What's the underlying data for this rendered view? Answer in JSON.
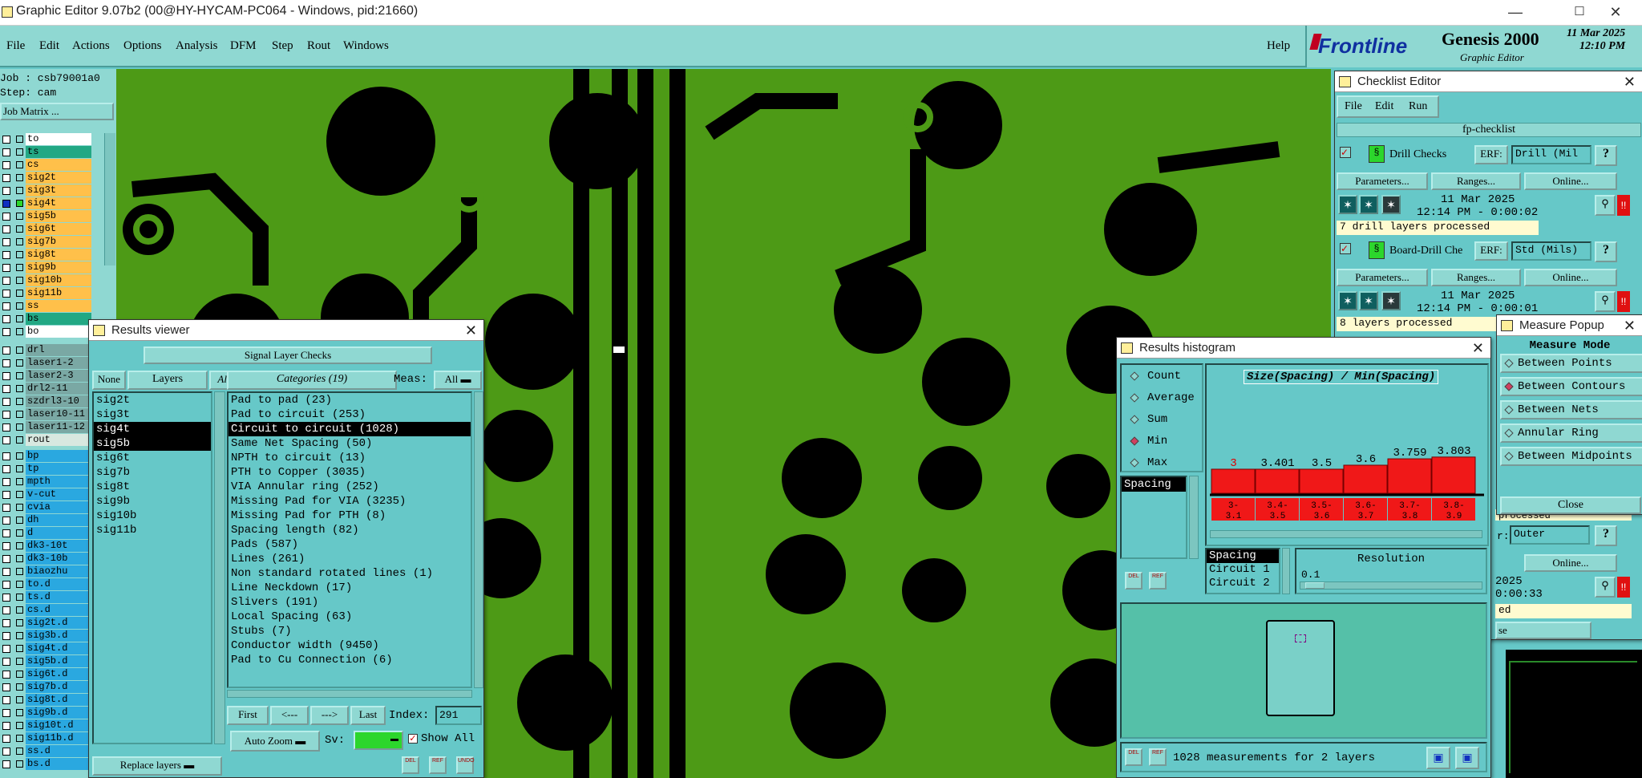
{
  "window": {
    "title": "Graphic Editor 9.07b2 (00@HY-HYCAM-PC064 - Windows, pid:21660)",
    "minimize": "—",
    "maximize": "☐",
    "close": "✕"
  },
  "menubar": {
    "items": [
      "File",
      "Edit",
      "Actions",
      "Options",
      "Analysis",
      "DFM",
      "Step",
      "Rout",
      "Windows"
    ],
    "help": "Help"
  },
  "brand": {
    "logo": "Frontline",
    "product": "Genesis 2000",
    "subtitle": "Graphic Editor",
    "date": "11 Mar 2025",
    "time": "12:10 PM"
  },
  "job": {
    "job": "Job : csb79001a0",
    "step": "Step: cam",
    "matrix_button": "Job Matrix ..."
  },
  "layers": {
    "group1": [
      {
        "name": "to",
        "color": "#ffffff"
      },
      {
        "name": "ts",
        "color": "#22a884"
      },
      {
        "name": "cs",
        "color": "#ffc04a"
      },
      {
        "name": "sig2t",
        "color": "#ffc04a"
      },
      {
        "name": "sig3t",
        "color": "#ffc04a"
      },
      {
        "name": "sig4t",
        "color": "#ffc04a"
      },
      {
        "name": "sig5b",
        "color": "#ffc04a"
      },
      {
        "name": "sig6t",
        "color": "#ffc04a"
      },
      {
        "name": "sig7b",
        "color": "#ffc04a"
      },
      {
        "name": "sig8t",
        "color": "#ffc04a"
      },
      {
        "name": "sig9b",
        "color": "#ffc04a"
      },
      {
        "name": "sig10b",
        "color": "#ffc04a"
      },
      {
        "name": "sig11b",
        "color": "#ffc04a"
      },
      {
        "name": "ss",
        "color": "#ffc04a"
      },
      {
        "name": "bs",
        "color": "#22a884"
      },
      {
        "name": "bo",
        "color": "#ffffff"
      }
    ],
    "group2": [
      "drl",
      "laser1-2",
      "laser2-3",
      "drl2-11",
      "szdrl3-10",
      "laser10-11",
      "laser11-12",
      "rout"
    ],
    "group3": [
      "bp",
      "tp",
      "mpth",
      "v-cut",
      "cvia",
      "dh",
      "d",
      "dk3-10t",
      "dk3-10b",
      "biaozhu",
      "to.d",
      "ts.d",
      "cs.d",
      "sig2t.d",
      "sig3b.d",
      "sig4t.d",
      "sig5b.d",
      "sig6t.d",
      "sig7b.d",
      "sig8t.d",
      "sig9b.d",
      "sig10t.d",
      "sig11b.d",
      "ss.d",
      "bs.d"
    ]
  },
  "results_viewer": {
    "title": "Results viewer",
    "header": "Signal Layer Checks",
    "none_btn": "None",
    "layers_btn": "Layers",
    "all_btn": "All",
    "layers": [
      "sig2t",
      "sig3t",
      "sig4t",
      "sig5b",
      "sig6t",
      "sig7b",
      "sig8t",
      "sig9b",
      "sig10b",
      "sig11b"
    ],
    "categories_btn": "Categories (19)",
    "meas_label": "Meas:",
    "meas_value": "All",
    "categories": [
      "Pad to pad (23)",
      "Pad to circuit (253)",
      "Circuit to circuit (1028)",
      "Same Net Spacing (50)",
      "NPTH to circuit (13)",
      "PTH to Copper (3035)",
      "VIA Annular ring (252)",
      "Missing Pad for VIA (3235)",
      "Missing Pad for PTH (8)",
      "Spacing length (82)",
      "Pads (587)",
      "Lines (261)",
      "Non standard rotated lines (1)",
      "Line Neckdown (17)",
      "Slivers (191)",
      "Local Spacing (63)",
      "Stubs (7)",
      "Conductor width (9450)",
      "Pad to Cu Connection (6)"
    ],
    "first": "First",
    "prev": "<---",
    "next": "--->",
    "last": "Last",
    "index_label": "Index:",
    "index_value": "291",
    "zoom": "Auto Zoom",
    "sv_label": "Sv:",
    "show_all": "Show All",
    "replace": "Replace layers",
    "icons": [
      "DEL",
      "REF",
      "UNDO"
    ]
  },
  "checklist": {
    "title": "Checklist Editor",
    "menu": [
      "File",
      "Edit",
      "Run"
    ],
    "name": "fp-checklist",
    "checks": [
      {
        "name": "Drill Checks",
        "erf_label": "ERF:",
        "erf": "Drill (Mil",
        "date": "11 Mar 2025",
        "time": "12:14 PM - 0:00:02",
        "status": "7 drill layers processed"
      },
      {
        "name": "Board-Drill Che",
        "erf_label": "ERF:",
        "erf": "Std (Mils)",
        "date": "11 Mar 2025",
        "time": "12:14 PM - 0:00:01",
        "status": "8 layers processed"
      }
    ],
    "params": "Parameters...",
    "ranges": "Ranges...",
    "online": "Online...",
    "third_erf": "Outer",
    "third_online": "Online...",
    "third_date": "2025",
    "third_time": "0:00:33",
    "third_status_fragment": "ed",
    "help": "?",
    "third_erf_label": "r:",
    "processed_fragment": "processed",
    "close_fragment": "se"
  },
  "measure": {
    "title": "Measure Popup",
    "header": "Measure Mode",
    "modes": [
      {
        "label": "Between Points",
        "on": false
      },
      {
        "label": "Between Contours",
        "on": true
      },
      {
        "label": "Between Nets",
        "on": false
      },
      {
        "label": "Annular Ring",
        "on": false
      },
      {
        "label": "Between Midpoints",
        "on": false
      }
    ],
    "close": "Close"
  },
  "histogram": {
    "title": "Results histogram",
    "options": [
      {
        "label": "Count",
        "on": false
      },
      {
        "label": "Average",
        "on": false
      },
      {
        "label": "Sum",
        "on": false
      },
      {
        "label": "Min",
        "on": true
      },
      {
        "label": "Max",
        "on": false
      }
    ],
    "chart_title": "Size(Spacing) / Min(Spacing)",
    "field_list": [
      "Spacing"
    ],
    "attr_list": [
      "Spacing",
      "Circuit 1",
      "Circuit 2"
    ],
    "resolution_label": "Resolution",
    "resolution": "0.1",
    "summary": "1028 measurements for 2 layers",
    "bottom_icons": [
      "DEL",
      "REF"
    ]
  },
  "chart_data": {
    "type": "bar",
    "title": "Size(Spacing) / Min(Spacing)",
    "categories": [
      "3-3.1",
      "3.4-3.5",
      "3.5-3.6",
      "3.6-3.7",
      "3.7-3.8",
      "3.8-3.9"
    ],
    "values": [
      3,
      3.401,
      3.5,
      3.6,
      3.759,
      3.803
    ],
    "labels": [
      "3",
      "3.401",
      "3.5",
      "3.6",
      "3.759",
      "3.803"
    ],
    "range_top": [
      "3-",
      "3.4-",
      "3.5-",
      "3.6-",
      "3.7-",
      "3.8-"
    ],
    "range_bottom": [
      "3.1",
      "3.5",
      "3.6",
      "3.7",
      "3.8",
      "3.9"
    ],
    "series_color": "#f01818"
  }
}
